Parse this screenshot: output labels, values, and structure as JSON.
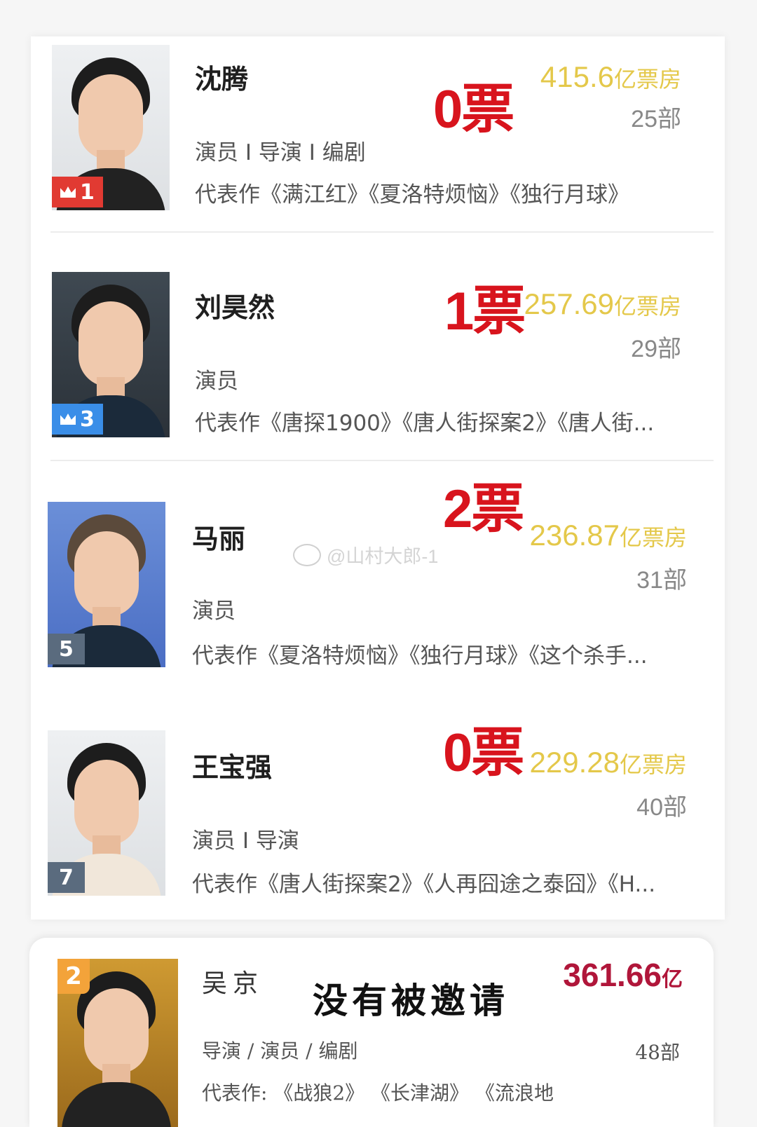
{
  "watermark": "@山村大郎-1",
  "cards": [
    {
      "name": "沈腾",
      "roles": "演员 I 导演 I 编剧",
      "works": "代表作《满江红》《夏洛特烦恼》《独行月球》",
      "votes": "0票",
      "box_value": "415.6",
      "box_unit": "亿票房",
      "count": "25部",
      "rank": "1"
    },
    {
      "name": "刘昊然",
      "roles": "演员",
      "works": "代表作《唐探1900》《唐人街探案2》《唐人街...",
      "votes": "1票",
      "box_value": "257.69",
      "box_unit": "亿票房",
      "count": "29部",
      "rank": "3"
    },
    {
      "name": "马丽",
      "roles": "演员",
      "works": "代表作《夏洛特烦恼》《独行月球》《这个杀手...",
      "votes": "2票",
      "box_value": "236.87",
      "box_unit": "亿票房",
      "count": "31部",
      "rank": "5"
    },
    {
      "name": "王宝强",
      "roles": "演员 I 导演",
      "works": "代表作《唐人街探案2》《人再囧途之泰囧》《H...",
      "votes": "0票",
      "box_value": "229.28",
      "box_unit": "亿票房",
      "count": "40部",
      "rank": "7"
    }
  ],
  "bottom_card": {
    "name": "吴京",
    "rank": "2",
    "roles": "导演 / 演员 / 编剧",
    "works": "代表作:  《战狼2》 《长津湖》 《流浪地",
    "box_value": "361.66",
    "box_unit": "亿",
    "count": "48部",
    "caption": "没有被邀请"
  }
}
